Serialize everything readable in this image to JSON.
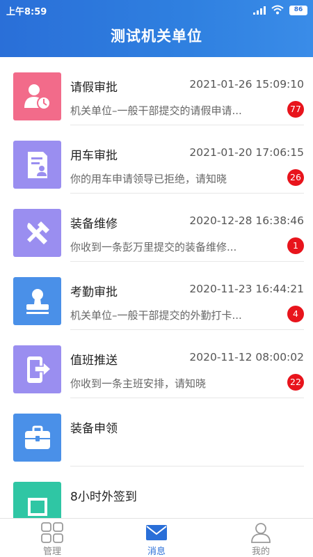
{
  "status": {
    "time": "上午8:59",
    "battery": "86"
  },
  "header": {
    "title": "测试机关单位"
  },
  "messages": [
    {
      "title": "请假审批",
      "time": "2021-01-26 15:09:10",
      "preview": "机关单位–一般干部提交的请假申请...",
      "badge": "77",
      "icon": "leave-approval-icon",
      "color": "#f26b8a"
    },
    {
      "title": "用车审批",
      "time": "2021-01-20 17:06:15",
      "preview": "你的用车申请领导已拒绝，请知晓",
      "badge": "26",
      "icon": "vehicle-approval-icon",
      "color": "#9a8ef0"
    },
    {
      "title": "装备维修",
      "time": "2020-12-28 16:38:46",
      "preview": "你收到一条彭万里提交的装备维修...",
      "badge": "1",
      "icon": "tools-icon",
      "color": "#9a8ef0"
    },
    {
      "title": "考勤审批",
      "time": "2020-11-23 16:44:21",
      "preview": "机关单位–一般干部提交的外勤打卡...",
      "badge": "4",
      "icon": "stamp-icon",
      "color": "#4a90e8"
    },
    {
      "title": "值班推送",
      "time": "2020-11-12 08:00:02",
      "preview": "你收到一条主班安排，请知晓",
      "badge": "22",
      "icon": "phone-exit-icon",
      "color": "#9a8ef0"
    },
    {
      "title": "装备申领",
      "time": "",
      "preview": "",
      "badge": "",
      "icon": "toolbox-icon",
      "color": "#4a90e8"
    },
    {
      "title": "8小时外签到",
      "time": "",
      "preview": "",
      "badge": "",
      "icon": "checkin-icon",
      "color": "#2fc6a4"
    }
  ],
  "nav": [
    {
      "label": "管理",
      "icon": "grid-icon",
      "active": false
    },
    {
      "label": "消息",
      "icon": "mail-icon",
      "active": true
    },
    {
      "label": "我的",
      "icon": "person-icon",
      "active": false
    }
  ],
  "colors": {
    "header": "#2a6fd8",
    "active": "#2a6fd8",
    "badge": "#e8141c"
  }
}
